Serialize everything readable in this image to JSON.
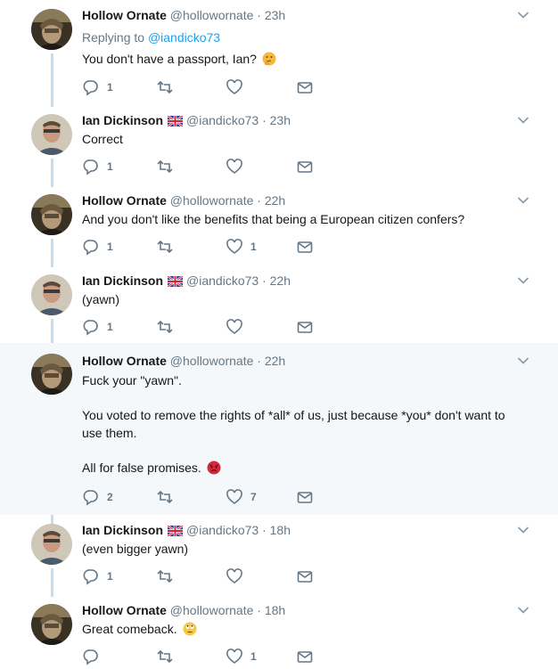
{
  "tweets": [
    {
      "name": "Hollow Ornate",
      "handle": "@hollowornate",
      "dot": "·",
      "time": "23h",
      "reply_to_prefix": "Replying to",
      "reply_to_handle": "@iandicko73",
      "text": "You don't have a passport, Ian?",
      "emoji": "thinking-face-emoji",
      "replies": "1",
      "retweets": "",
      "likes": ""
    },
    {
      "name": "Ian Dickinson",
      "handle": "@iandicko73",
      "dot": "·",
      "time": "23h",
      "flag": "uk-flag-icon",
      "text": "Correct",
      "replies": "1",
      "retweets": "",
      "likes": ""
    },
    {
      "name": "Hollow Ornate",
      "handle": "@hollowornate",
      "dot": "·",
      "time": "22h",
      "text": "And you don't like the benefits that being a European citizen confers?",
      "replies": "1",
      "retweets": "",
      "likes": "1"
    },
    {
      "name": "Ian Dickinson",
      "handle": "@iandicko73",
      "dot": "·",
      "time": "22h",
      "flag": "uk-flag-icon",
      "text": "(yawn)",
      "replies": "1",
      "retweets": "",
      "likes": ""
    },
    {
      "name": "Hollow Ornate",
      "handle": "@hollowornate",
      "dot": "·",
      "time": "22h",
      "text_lines": [
        "Fuck your \"yawn\".",
        "You voted to remove the rights of *all* of us, just because *you* don't want to",
        "use them.",
        "All for false promises."
      ],
      "emoji": "angry-face-emoji",
      "replies": "2",
      "retweets": "",
      "likes": "7"
    },
    {
      "name": "Ian Dickinson",
      "handle": "@iandicko73",
      "dot": "·",
      "time": "18h",
      "flag": "uk-flag-icon",
      "text": "(even bigger yawn)",
      "replies": "1",
      "retweets": "",
      "likes": ""
    },
    {
      "name": "Hollow Ornate",
      "handle": "@hollowornate",
      "dot": "·",
      "time": "18h",
      "text": "Great comeback.",
      "emoji": "eye-roll-emoji",
      "replies": "",
      "retweets": "",
      "likes": "1"
    }
  ],
  "colors": {
    "accent": "#1da1f2",
    "muted": "#657786",
    "thread_line": "#c4dcef",
    "highlight_bg": "#f5f8fa"
  }
}
